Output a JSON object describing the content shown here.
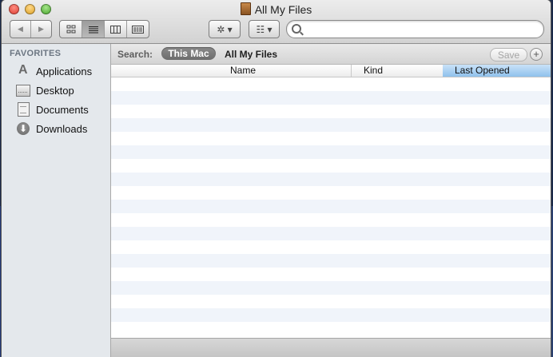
{
  "window": {
    "title": "All My Files"
  },
  "toolbar": {
    "back_glyph": "◀",
    "forward_glyph": "▶",
    "view_modes": [
      "icon-view",
      "list-view",
      "column-view",
      "cover-flow-view"
    ],
    "active_view": "list-view",
    "action_glyph": "✲ ▾",
    "arrange_glyph": "☷ ▾",
    "search_placeholder": "",
    "search_value": ""
  },
  "sidebar": {
    "heading": "FAVORITES",
    "items": [
      {
        "label": "Applications",
        "icon": "applications-icon"
      },
      {
        "label": "Desktop",
        "icon": "desktop-icon"
      },
      {
        "label": "Documents",
        "icon": "documents-icon"
      },
      {
        "label": "Downloads",
        "icon": "downloads-icon"
      }
    ]
  },
  "searchbar": {
    "label": "Search:",
    "scope_selected": "This Mac",
    "scope_other": "All My Files",
    "save_label": "Save",
    "add_label": "+"
  },
  "table": {
    "columns": [
      "Name",
      "Kind",
      "Last Opened"
    ],
    "sorted_column": "Last Opened",
    "rows": []
  },
  "colors": {
    "sidebar_bg": "#e4e8ec",
    "stripe": "#f0f4fa",
    "sort_header": "#8fc1ec"
  }
}
